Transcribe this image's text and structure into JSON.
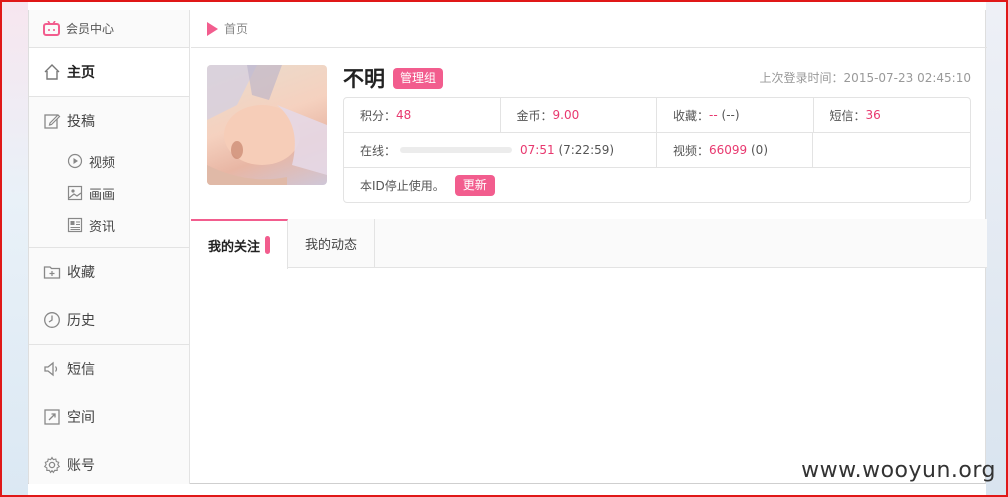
{
  "sidebar": {
    "header": "会员中心",
    "items": [
      {
        "label": "主页"
      },
      {
        "label": "投稿"
      },
      {
        "label": "收藏"
      },
      {
        "label": "历史"
      },
      {
        "label": "短信"
      },
      {
        "label": "空间"
      },
      {
        "label": "账号"
      }
    ],
    "sub_items": [
      {
        "label": "视频"
      },
      {
        "label": "画画"
      },
      {
        "label": "资讯"
      }
    ]
  },
  "breadcrumb": {
    "home": "首页"
  },
  "profile": {
    "name": "不明",
    "group_badge": "管理组",
    "last_login": "上次登录时间：2015-07-23 02:45:10"
  },
  "stats": {
    "points_label": "积分：",
    "points_value": "48",
    "coins_label": "金币：",
    "coins_value": "9.00",
    "favs_label": "收藏：",
    "favs_value": "--",
    "favs_extra": "(--)",
    "msgs_label": "短信：",
    "msgs_value": "36",
    "online_label": "在线：",
    "online_value": "07:51",
    "online_extra": "(7:22:59)",
    "online_progress": 0,
    "videos_label": "视频：",
    "videos_value": "66099",
    "videos_extra": "(0)",
    "notice": "本ID停止使用。",
    "renew_label": "更新"
  },
  "tabs": [
    {
      "label": "我的关注"
    },
    {
      "label": "我的动态"
    }
  ],
  "watermark": "www.wooyun.org",
  "colors": {
    "accent": "#f25d8e",
    "value": "#e8386f",
    "frame": "#e01818"
  }
}
